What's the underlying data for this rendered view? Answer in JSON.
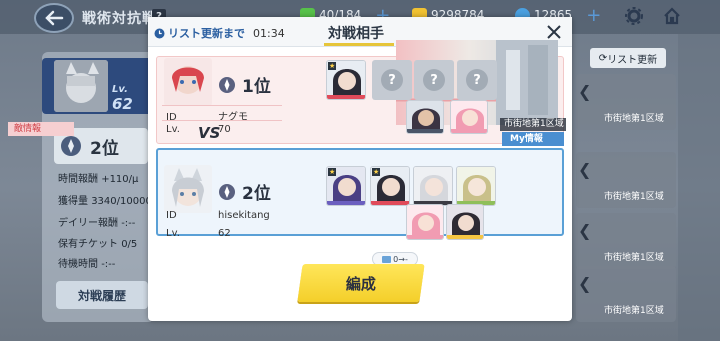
{
  "header": {
    "title": "戦術対抗戦",
    "help": "?",
    "tickets": "40/184",
    "credits": "9298784",
    "gems": "12865"
  },
  "background": {
    "player_level_label": "Lv.",
    "player_level": "62",
    "rank": "2位",
    "stats": [
      {
        "label": "時間報酬",
        "value": "+110/μ"
      },
      {
        "label": "獲得量",
        "value": "3340/10000"
      },
      {
        "label": "デイリー報酬",
        "value": "-:--"
      },
      {
        "label": "保有チケット",
        "value": "0/5"
      },
      {
        "label": "待機時間",
        "value": "-:--"
      }
    ],
    "history_button": "対戦履歴",
    "refresh_button": "リスト更新",
    "card_labels": [
      "市街地第1区域",
      "市街地第1区域",
      "市街地第1区域",
      "市街地第1区域"
    ]
  },
  "modal": {
    "timer_label": "リスト更新まで",
    "timer_value": "01:34",
    "title": "対戦相手",
    "vs": "VS",
    "fight_label": "編成",
    "cost_text": "0→-"
  },
  "enemy": {
    "rank": "1位",
    "id_label": "ID",
    "id": "ナグモ",
    "lv_label": "Lv.",
    "lv": "70",
    "tag": "敵情報",
    "map": "市街地第1区域",
    "empty_slot_glyph": "?"
  },
  "me": {
    "rank": "2位",
    "id_label": "ID",
    "id": "hisekitang",
    "lv_label": "Lv.",
    "lv": "62",
    "tag": "My情報"
  },
  "colors": {
    "accent_blue": "#4a8ed0",
    "enemy_pink": "#f6cfd1",
    "fight_yellow": "#f4cf2a"
  }
}
